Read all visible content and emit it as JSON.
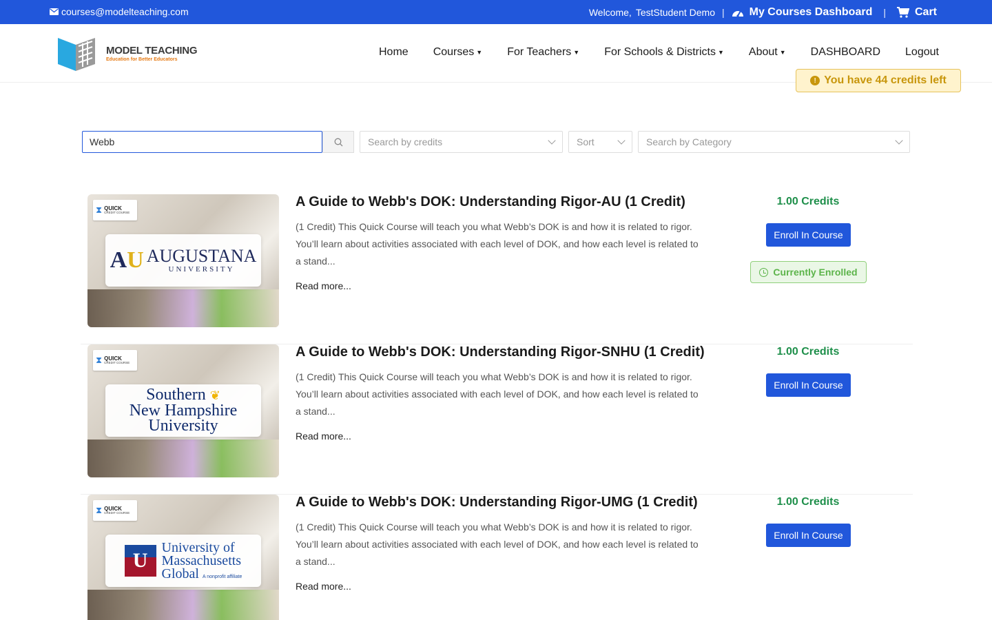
{
  "topbar": {
    "email": "courses@modelteaching.com",
    "welcome_label": "Welcome,",
    "user_name": "TestStudent Demo",
    "dashboard_label": "My Courses Dashboard",
    "cart_label": "Cart",
    "icons": {
      "email": "envelope-icon",
      "dashboard": "tachometer-icon",
      "cart": "cart-icon"
    }
  },
  "header": {
    "logo_brand": "MODEL TEACHING",
    "logo_tagline": "Education for Better Educators",
    "nav": [
      {
        "label": "Home",
        "dropdown": false
      },
      {
        "label": "Courses",
        "dropdown": true
      },
      {
        "label": "For Teachers",
        "dropdown": true
      },
      {
        "label": "For Schools & Districts",
        "dropdown": true
      },
      {
        "label": "About",
        "dropdown": true
      },
      {
        "label": "DASHBOARD",
        "dropdown": false
      },
      {
        "label": "Logout",
        "dropdown": false
      }
    ],
    "credits_notice": "You have 44 credits left"
  },
  "filters": {
    "search_value": "Webb",
    "credits_placeholder": "Search by credits",
    "sort_placeholder": "Sort",
    "category_placeholder": "Search by Category"
  },
  "course_badge": {
    "quick": "QUICK",
    "credit_course": "CREDIT COURSE"
  },
  "courses": [
    {
      "title": "A Guide to Webb's DOK: Understanding Rigor-AU (1 Credit)",
      "description": "(1 Credit) This Quick Course will teach you what Webb’s DOK is and how it is related to rigor. You’ll learn about activities associated with each level of DOK, and how each level is related to a stand...",
      "read_more": "Read more...",
      "credits": "1.00 Credits",
      "enroll_label": "Enroll In Course",
      "enrolled_label": "Currently Enrolled",
      "logo": {
        "mark_a": "A",
        "mark_u": "U",
        "name": "AUGUSTANA",
        "sub": "UNIVERSITY"
      }
    },
    {
      "title": "A Guide to Webb's DOK: Understanding Rigor-SNHU (1 Credit)",
      "description": "(1 Credit) This Quick Course will teach you what Webb’s DOK is and how it is related to rigor. You’ll learn about activities associated with each level of DOK, and how each level is related to a stand...",
      "read_more": "Read more...",
      "credits": "1.00 Credits",
      "enroll_label": "Enroll In Course",
      "logo": {
        "line1": "Southern",
        "line2": "New Hampshire",
        "line3": "University"
      }
    },
    {
      "title": "A Guide to Webb's DOK: Understanding Rigor-UMG (1 Credit)",
      "description": "(1 Credit) This Quick Course will teach you what Webb’s DOK is and how it is related to rigor. You’ll learn about activities associated with each level of DOK, and how each level is related to a stand...",
      "read_more": "Read more...",
      "credits": "1.00 Credits",
      "enroll_label": "Enroll In Course",
      "logo": {
        "line1": "University of",
        "line2": "Massachusetts",
        "line3": "Global",
        "affiliate": "A nonprofit affiliate"
      }
    }
  ],
  "colors": {
    "primary": "#2157db",
    "credits_green": "#1e8f4a",
    "notice_bg": "#fff3cd",
    "notice_text": "#c8960c",
    "enrolled_green": "#5cb44a"
  }
}
